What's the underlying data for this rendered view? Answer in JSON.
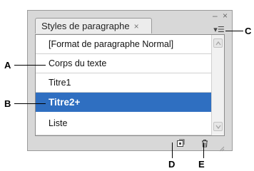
{
  "panel": {
    "tab_label": "Styles de paragraphe",
    "tab_close": "×",
    "window_controls": "– ×",
    "menu_glyph": "▾☰",
    "styles": [
      {
        "label": "[Format de paragraphe Normal]",
        "selected": false
      },
      {
        "label": "Corps du texte",
        "selected": false
      },
      {
        "label": "Titre1",
        "selected": false
      },
      {
        "label": "Titre2+",
        "selected": true
      },
      {
        "label": "Liste",
        "selected": false
      }
    ],
    "footer_icons": [
      "new-style-icon",
      "trash-icon"
    ]
  },
  "callouts": {
    "A": "A",
    "B": "B",
    "C": "C",
    "D": "D",
    "E": "E"
  },
  "colors": {
    "selection": "#2f6fc1",
    "panel_bg": "#d8d8d8"
  }
}
